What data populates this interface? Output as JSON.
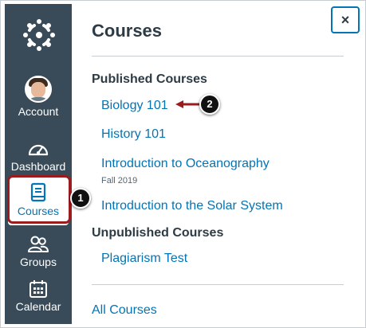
{
  "nav": {
    "items": [
      {
        "label": "Account",
        "icon": "avatar"
      },
      {
        "label": "Dashboard",
        "icon": "dashboard-gauge-icon"
      },
      {
        "label": "Courses",
        "icon": "book-icon",
        "active": true
      },
      {
        "label": "Groups",
        "icon": "people-icon"
      },
      {
        "label": "Calendar",
        "icon": "calendar-icon"
      }
    ],
    "logo": "canvas-logo-icon"
  },
  "tray": {
    "title": "Courses",
    "close_label": "×",
    "published_heading": "Published Courses",
    "published_courses": [
      {
        "name": "Biology 101"
      },
      {
        "name": "History 101"
      },
      {
        "name": "Introduction to Oceanography",
        "term": "Fall 2019"
      },
      {
        "name": "Introduction to the Solar System"
      }
    ],
    "unpublished_heading": "Unpublished Courses",
    "unpublished_courses": [
      {
        "name": "Plagiarism Test"
      }
    ],
    "all_courses_label": "All Courses"
  },
  "callouts": {
    "one": "1",
    "two": "2"
  },
  "colors": {
    "nav_bg": "#394b58",
    "link": "#0374b5",
    "highlight": "#9b1b1f",
    "text": "#2d3b45"
  }
}
